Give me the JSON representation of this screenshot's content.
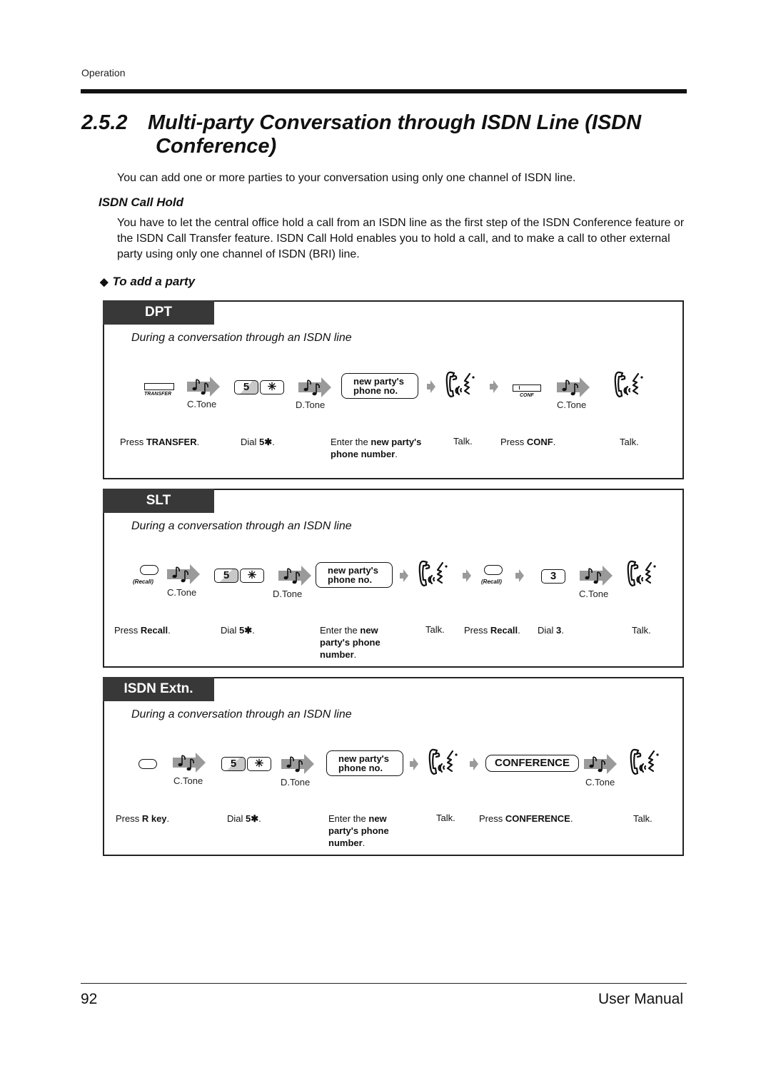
{
  "header": {
    "running_head": "Operation"
  },
  "section": {
    "number": "2.5.2",
    "title_line1": "Multi-party Conversation through ISDN Line (ISDN",
    "title_line2": "Conference)",
    "intro": "You can add one or more parties to your conversation using only one channel of ISDN line.",
    "subheading": "ISDN Call Hold",
    "paragraph": "You have to let the central office hold a call from an ISDN line as the first step of the ISDN Conference feature or the ISDN Call Transfer feature. ISDN Call Hold enables you to hold a call, and to make a call to other external party using only one channel of ISDN (BRI) line.",
    "bullet_symbol": "◆",
    "bullet_heading": "To add a party"
  },
  "common": {
    "subtitle": "During a conversation through an ISDN line",
    "c_tone": "C.Tone",
    "d_tone": "D.Tone",
    "key_5": "5",
    "key_star": "✳",
    "entry_line1": "new party's",
    "entry_line2": "phone no.",
    "talk": "Talk."
  },
  "panels": {
    "dpt": {
      "tab": "DPT",
      "transfer_label": "TRANSFER",
      "conf_label": "CONF",
      "captions": {
        "press_transfer_pre": "Press ",
        "press_transfer_bold": "TRANSFER",
        "dial_pre": "Dial ",
        "dial_bold": "5✱",
        "enter_pre": "Enter the ",
        "enter_bold1": "new party's",
        "enter_bold2": "phone number",
        "press_conf_pre": "Press ",
        "press_conf_bold": "CONF"
      }
    },
    "slt": {
      "tab": "SLT",
      "recall_label": "(Recall)",
      "key_3": "3",
      "captions": {
        "press_recall_pre": "Press ",
        "press_recall_bold": "Recall",
        "dial_pre": "Dial ",
        "dial_bold": "5✱",
        "enter_pre": "Enter the ",
        "enter_bold1": "new",
        "enter_bold2": "party's phone",
        "enter_bold3": "number",
        "press_recall2_pre": "Press ",
        "press_recall2_bold": "Recall",
        "dial3_pre": "Dial ",
        "dial3_bold": "3"
      }
    },
    "isdn": {
      "tab": "ISDN Extn.",
      "conference_key": "CONFERENCE",
      "captions": {
        "press_r_pre": "Press ",
        "press_r_bold": "R key",
        "dial_pre": "Dial ",
        "dial_bold": "5✱",
        "enter_pre": "Enter the ",
        "enter_bold1": "new",
        "enter_bold2": "party's phone",
        "enter_bold3": "number",
        "press_conference_pre": "Press ",
        "press_conference_bold": "CONFERENCE"
      }
    }
  },
  "footer": {
    "page_number": "92",
    "manual_title": "User Manual"
  }
}
